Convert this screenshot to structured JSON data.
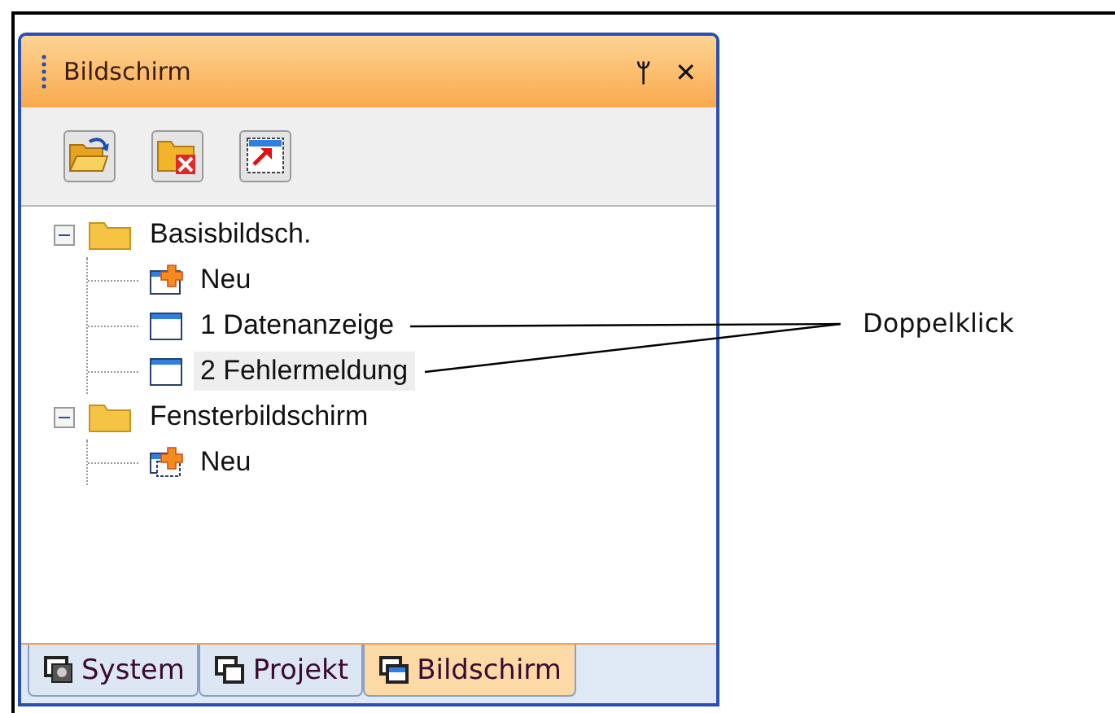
{
  "panel": {
    "title": "Bildschirm",
    "pin_button": "ᛘ",
    "close_button": "✕"
  },
  "toolbar": [
    {
      "kind": "open"
    },
    {
      "kind": "delete"
    },
    {
      "kind": "export"
    }
  ],
  "tree": [
    {
      "label": "Basisbildsch.",
      "kind": "folder",
      "expanded": true,
      "selected": false,
      "annotated": false,
      "children": [
        {
          "label": "Neu",
          "kind": "new",
          "selected": false,
          "annotated": false
        },
        {
          "label": "1 Datenanzeige",
          "kind": "screen",
          "selected": false,
          "annotated": true
        },
        {
          "label": "2 Fehlermeldung",
          "kind": "screen",
          "selected": true,
          "annotated": true
        }
      ]
    },
    {
      "label": "Fensterbildschirm",
      "kind": "folder",
      "expanded": true,
      "selected": false,
      "annotated": false,
      "children": [
        {
          "label": "Neu",
          "kind": "new-window",
          "selected": false,
          "annotated": false
        }
      ]
    }
  ],
  "tabs": [
    {
      "label": "System",
      "kind": "system",
      "selected": false
    },
    {
      "label": "Projekt",
      "kind": "project",
      "selected": false
    },
    {
      "label": "Bildschirm",
      "kind": "screen",
      "selected": true
    }
  ],
  "annotation": {
    "text": "Doppelklick"
  }
}
